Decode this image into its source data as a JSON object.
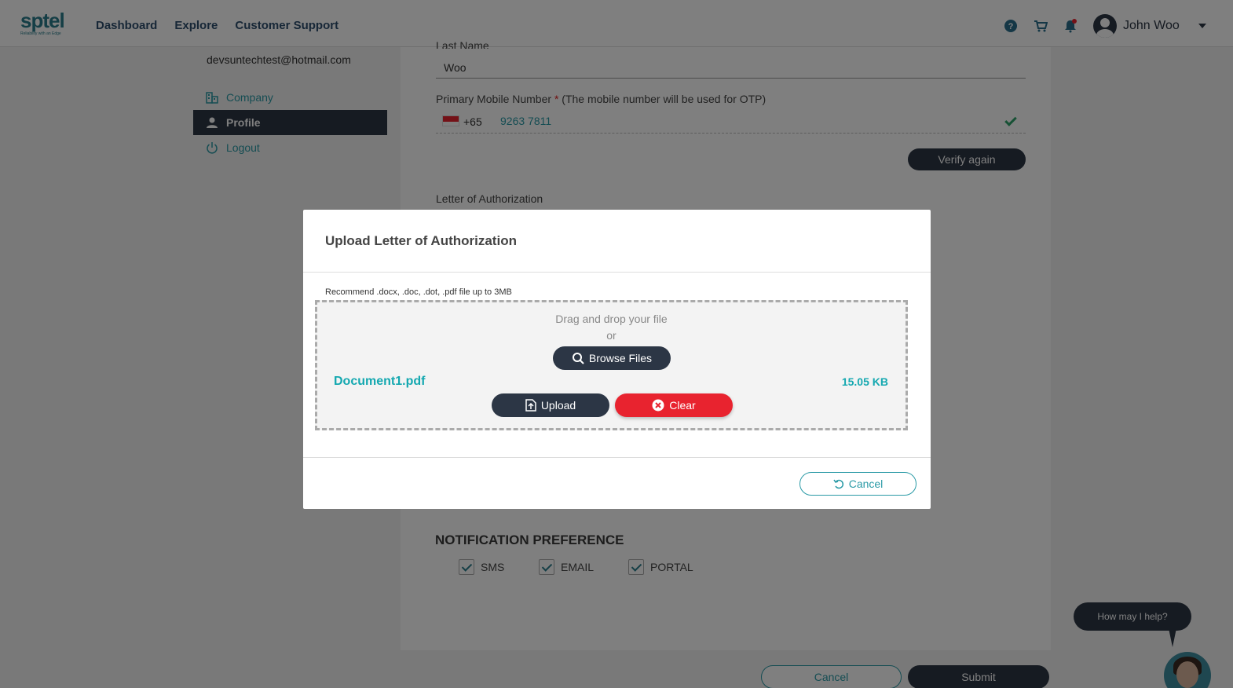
{
  "header": {
    "logo": "sptel",
    "logo_tagline": "Reliability with an Edge",
    "nav": [
      "Dashboard",
      "Explore",
      "Customer Support"
    ],
    "user_name": "John Woo"
  },
  "sidebar": {
    "email": "devsuntechtest@hotmail.com",
    "items": [
      {
        "label": "Company"
      },
      {
        "label": "Profile"
      },
      {
        "label": "Logout"
      }
    ]
  },
  "form": {
    "last_name_label": "Last Name",
    "last_name_value": "Woo",
    "mobile_label": "Primary Mobile Number",
    "required_mark": "*",
    "mobile_note": "(The mobile number will be used for OTP)",
    "country_code": "+65",
    "mobile_value": "9263 7811",
    "verify_button": "Verify again",
    "loa_label": "Letter of Authorization",
    "notification_title": "NOTIFICATION PREFERENCE",
    "notifications": [
      "SMS",
      "EMAIL",
      "PORTAL"
    ],
    "cancel_button": "Cancel",
    "submit_button": "Submit"
  },
  "modal": {
    "title": "Upload Letter of Authorization",
    "hint": "Recommend .docx, .doc, .dot, .pdf file up to 3MB",
    "drag_text": "Drag and drop your file",
    "or_text": "or",
    "browse_button": "Browse Files",
    "file_name": "Document1.pdf",
    "file_size": "15.05 KB",
    "upload_button": "Upload",
    "clear_button": "Clear",
    "cancel_button": "Cancel"
  },
  "chat": {
    "prompt": "How may I help?"
  },
  "colors": {
    "primary_dark": "#2c3645",
    "accent_teal": "#14a8b0",
    "danger_red": "#e8232f"
  }
}
